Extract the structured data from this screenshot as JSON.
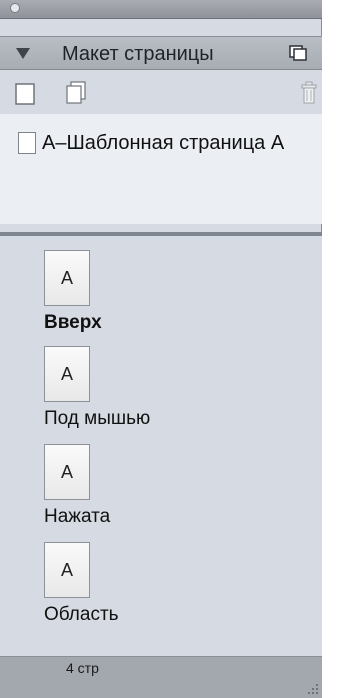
{
  "panel": {
    "header_title": "Макет страницы"
  },
  "masters": [
    {
      "label": "A–Шаблонная страница A"
    }
  ],
  "pages": [
    {
      "thumb": "A",
      "label": "Вверх",
      "selected": true
    },
    {
      "thumb": "A",
      "label": "Под мышью",
      "selected": false
    },
    {
      "thumb": "A",
      "label": "Нажата",
      "selected": false
    },
    {
      "thumb": "A",
      "label": "Область",
      "selected": false
    }
  ],
  "status": {
    "page_count": "4 стр"
  },
  "icons": {
    "collapse": "triangle-down-icon",
    "panel_menu": "panel-menu-icon",
    "new_page": "new-page-icon",
    "duplicate_page": "duplicate-page-icon",
    "delete": "trash-icon",
    "resize": "resize-grip-icon"
  }
}
